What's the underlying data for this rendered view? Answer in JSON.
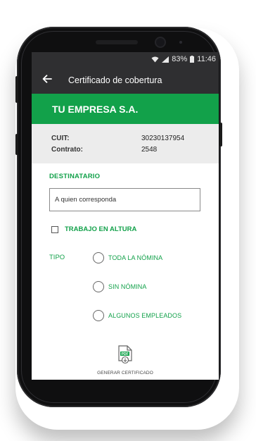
{
  "status_bar": {
    "battery": "83%",
    "time": "11:46"
  },
  "app_bar": {
    "title": "Certificado de cobertura"
  },
  "company": {
    "name": "TU EMPRESA S.A."
  },
  "info": {
    "cuit_label": "CUIT:",
    "cuit_value": "30230137954",
    "contrato_label": "Contrato:",
    "contrato_value": "2548"
  },
  "destinatario": {
    "label": "DESTINATARIO",
    "value": "A quien corresponda"
  },
  "trabajo_altura": {
    "label": "TRABAJO EN ALTURA",
    "checked": false
  },
  "tipo": {
    "label": "TIPO",
    "options": [
      "TODA LA NÓMINA",
      "SIN NÓMINA",
      "ALGUNOS EMPLEADOS"
    ]
  },
  "generate": {
    "label": "GENERAR CERTIFICADO",
    "icon_text": "PDF"
  },
  "colors": {
    "accent": "#12a14a",
    "appbar": "#2f2f31",
    "info_bg": "#ececec"
  },
  "icons": [
    "back-arrow-icon",
    "wifi-icon",
    "signal-icon",
    "battery-icon",
    "pdf-download-icon"
  ]
}
